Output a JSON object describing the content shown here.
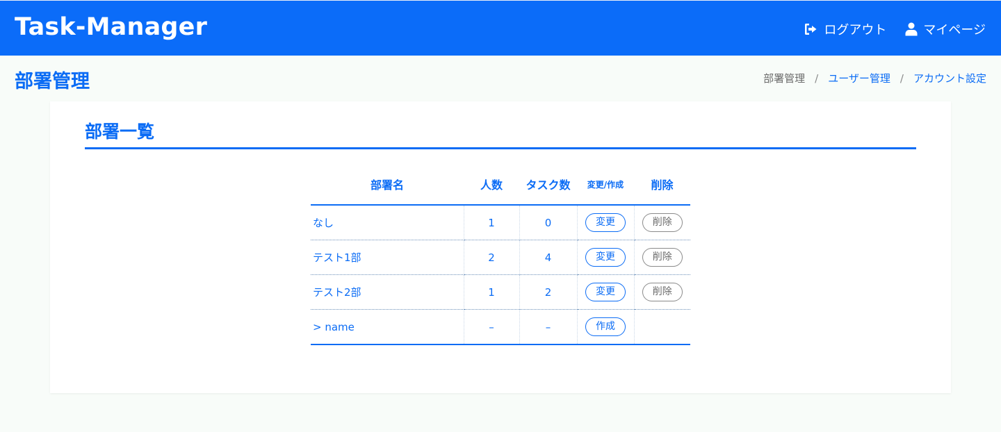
{
  "header": {
    "brand": "Task-Manager",
    "nav": {
      "logout_label": "ログアウト",
      "mypage_label": "マイページ"
    }
  },
  "page": {
    "title": "部署管理",
    "breadcrumb": [
      "部署管理",
      "ユーザー管理",
      "アカウント設定"
    ]
  },
  "section": {
    "title": "部署一覧"
  },
  "table": {
    "columns": [
      "部署名",
      "人数",
      "タスク数",
      "変更/作成",
      "削除"
    ],
    "rows": [
      {
        "name": "なし",
        "members": "1",
        "tasks": "0",
        "edit": "変更",
        "delete": "削除"
      },
      {
        "name": "テスト1部",
        "members": "2",
        "tasks": "4",
        "edit": "変更",
        "delete": "削除"
      },
      {
        "name": "テスト2部",
        "members": "1",
        "tasks": "2",
        "edit": "変更",
        "delete": "削除"
      }
    ],
    "new_row": {
      "name": "> name",
      "members": "–",
      "tasks": "–",
      "create": "作成"
    }
  },
  "colors": {
    "primary": "#0b6cf9",
    "text_blue": "#0b6cf5",
    "muted_gray": "#6b6b6b",
    "background": "#f8fcf9"
  },
  "icons": [
    "logout-icon",
    "user-icon"
  ]
}
